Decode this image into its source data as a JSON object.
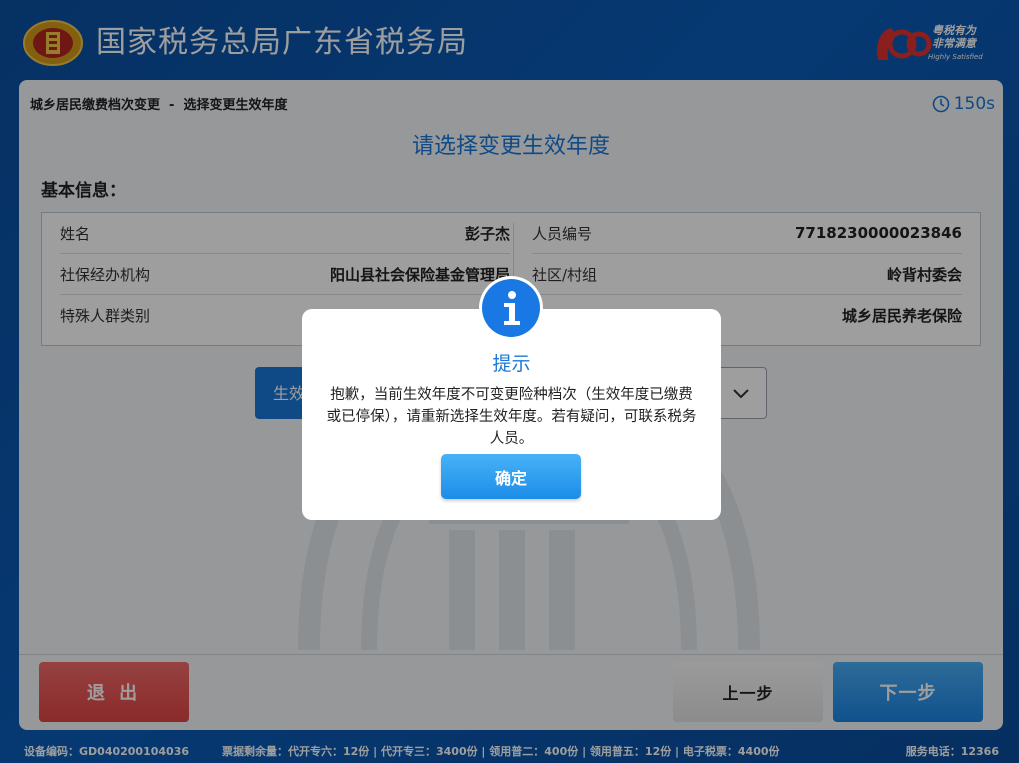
{
  "header": {
    "title": "国家税务总局广东省税务局",
    "badge_line1": "粤税有为",
    "badge_line2": "非常满意",
    "badge_line3": "Highly Satisfied"
  },
  "page": {
    "breadcrumb": "城乡居民缴费档次变更  -  选择变更生效年度",
    "timer": "150s",
    "heading": "请选择变更生效年度",
    "section_title": "基本信息："
  },
  "info": {
    "left": [
      {
        "label": "姓名",
        "value": "彭子杰"
      },
      {
        "label": "社保经办机构",
        "value": "阳山县社会保险基金管理局"
      },
      {
        "label": "特殊人群类别",
        "value": ""
      }
    ],
    "right": [
      {
        "label": "人员编号",
        "value": "7718230000023846"
      },
      {
        "label": "社区/村组",
        "value": "岭背村委会"
      },
      {
        "label": "",
        "value": "城乡居民养老保险"
      }
    ]
  },
  "selector": {
    "label": "生效"
  },
  "buttons": {
    "exit": "退 出",
    "prev": "上一步",
    "next": "下一步"
  },
  "status": {
    "device": "设备编码：GD040200104036",
    "tickets": "票据剩余量：代开专六：12份 | 代开专三：3400份 | 领用普二：400份 | 领用普五：12份 | 电子税票：4400份",
    "phone": "服务电话：12366"
  },
  "modal": {
    "title": "提示",
    "message": "抱歉，当前生效年度不可变更险种档次（生效年度已缴费或已停保），请重新选择生效年度。若有疑问，可联系税务人员。",
    "confirm": "确定"
  },
  "colors": {
    "brand_blue": "#1a78d8",
    "exit_red": "#e04444",
    "next_blue": "#1a84e4"
  }
}
